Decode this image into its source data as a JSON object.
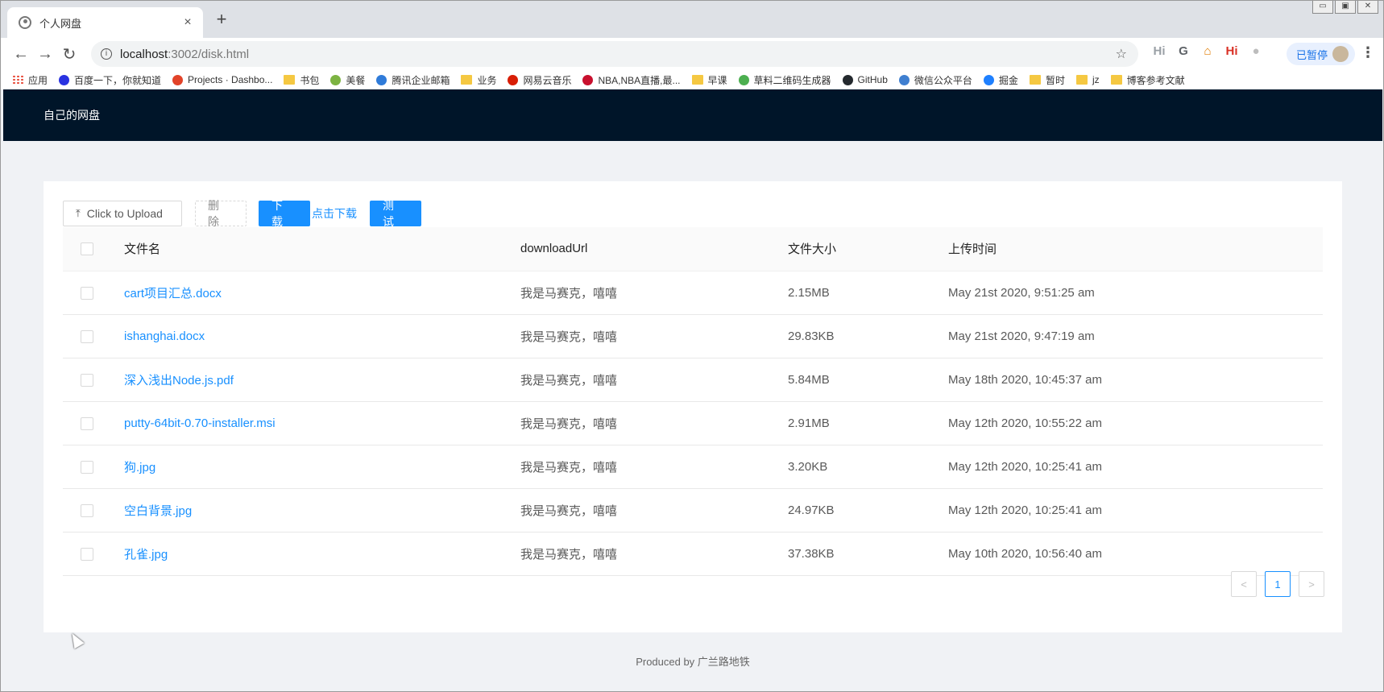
{
  "browser": {
    "tab_title": "个人网盘",
    "tab_close": "×",
    "new_tab": "+",
    "window_controls": [
      "▭",
      "▣",
      "✕"
    ],
    "url_host": "localhost",
    "url_path": ":3002/disk.html",
    "paused_label": "已暂停",
    "extensions": [
      {
        "label": "Hi",
        "color": "#9aa0a6"
      },
      {
        "label": "G",
        "color": "#5f6368"
      },
      {
        "label": "⌂",
        "color": "#e07b00"
      },
      {
        "label": "Hi",
        "color": "#d93025"
      },
      {
        "label": "●",
        "color": "#bdbdbd"
      }
    ],
    "bookmarks": [
      {
        "label": "应用",
        "icon": "apps-icon"
      },
      {
        "label": "百度一下，你就知道",
        "icon": "baidu-icon",
        "color": "#2932e1"
      },
      {
        "label": "Projects · Dashbo...",
        "icon": "gitlab-icon",
        "color": "#e24329"
      },
      {
        "label": "书包",
        "icon": "folder-icon"
      },
      {
        "label": "美餐",
        "icon": "meican-icon",
        "color": "#7cb342"
      },
      {
        "label": "腾讯企业邮箱",
        "icon": "tencent-mail-icon",
        "color": "#2f7bd9"
      },
      {
        "label": "业务",
        "icon": "folder-icon"
      },
      {
        "label": "网易云音乐",
        "icon": "netease-music-icon",
        "color": "#d81e06"
      },
      {
        "label": "NBA,NBA直播,最...",
        "icon": "nba-icon",
        "color": "#c8102e"
      },
      {
        "label": "早课",
        "icon": "folder-icon"
      },
      {
        "label": "草料二维码生成器",
        "icon": "qrcode-icon",
        "color": "#4caf50"
      },
      {
        "label": "GitHub",
        "icon": "github-icon",
        "color": "#24292e"
      },
      {
        "label": "微信公众平台",
        "icon": "wechat-mp-icon",
        "color": "#3f7fd0"
      },
      {
        "label": "掘金",
        "icon": "juejin-icon",
        "color": "#1e80ff"
      },
      {
        "label": "暂时",
        "icon": "folder-icon"
      },
      {
        "label": "jz",
        "icon": "folder-icon"
      },
      {
        "label": "博客参考文献",
        "icon": "folder-icon"
      }
    ]
  },
  "app": {
    "header_title": "自己的网盘",
    "actions": {
      "upload": "Click to Upload",
      "delete": "删除",
      "download": "下载",
      "download_link": "点击下载",
      "test": "测试"
    },
    "table": {
      "columns": [
        "文件名",
        "downloadUrl",
        "文件大小",
        "上传时间"
      ],
      "rows": [
        {
          "name": "cart项目汇总.docx",
          "url": "我是马赛克，嘻嘻",
          "size": "2.15MB",
          "time": "May 21st 2020, 9:51:25 am"
        },
        {
          "name": "ishanghai.docx",
          "url": "我是马赛克，嘻嘻",
          "size": "29.83KB",
          "time": "May 21st 2020, 9:47:19 am"
        },
        {
          "name": "深入浅出Node.js.pdf",
          "url": "我是马赛克，嘻嘻",
          "size": "5.84MB",
          "time": "May 18th 2020, 10:45:37 am"
        },
        {
          "name": "putty-64bit-0.70-installer.msi",
          "url": "我是马赛克，嘻嘻",
          "size": "2.91MB",
          "time": "May 12th 2020, 10:55:22 am"
        },
        {
          "name": "狗.jpg",
          "url": "我是马赛克，嘻嘻",
          "size": "3.20KB",
          "time": "May 12th 2020, 10:25:41 am"
        },
        {
          "name": "空白背景.jpg",
          "url": "我是马赛克，嘻嘻",
          "size": "24.97KB",
          "time": "May 12th 2020, 10:25:41 am"
        },
        {
          "name": "孔雀.jpg",
          "url": "我是马赛克，嘻嘻",
          "size": "37.38KB",
          "time": "May 10th 2020, 10:56:40 am"
        }
      ]
    },
    "pagination": {
      "current": "1",
      "prev": "<",
      "next": ">"
    },
    "footer": "Produced by 广兰路地铁"
  }
}
